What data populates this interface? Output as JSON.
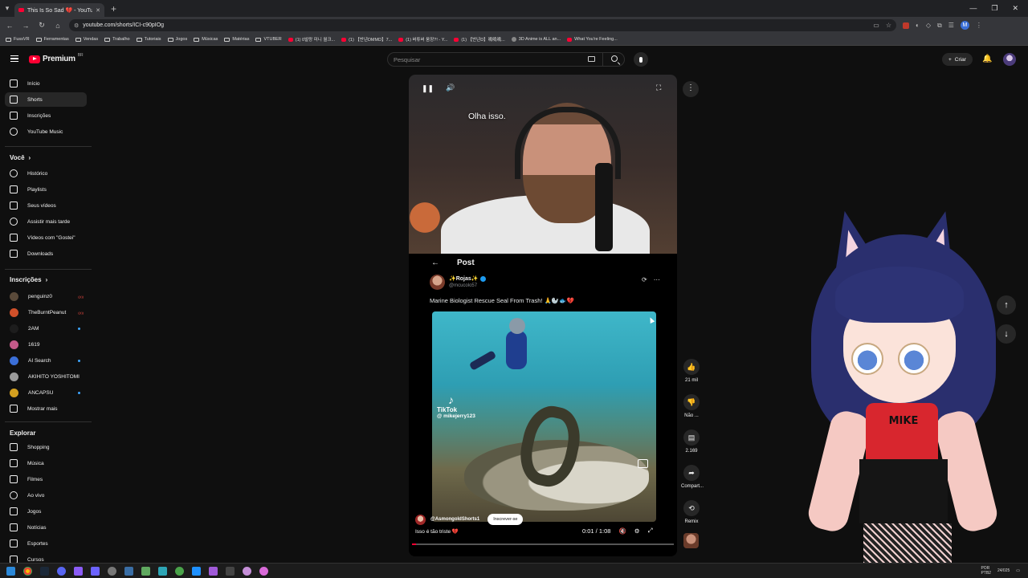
{
  "browser": {
    "tab_title": "This Is So Sad 💔 - YouTub",
    "url": "youtube.com/shorts/ICI-c90pIOg",
    "profile_initial": "M",
    "bookmarks": [
      {
        "label": "FussVR",
        "icon": "folder"
      },
      {
        "label": "Ferramentas",
        "icon": "folder"
      },
      {
        "label": "Vendas",
        "icon": "folder"
      },
      {
        "label": "Trabalho",
        "icon": "folder"
      },
      {
        "label": "Tutoriais",
        "icon": "folder"
      },
      {
        "label": "Jogos",
        "icon": "folder"
      },
      {
        "label": "Músicas",
        "icon": "folder"
      },
      {
        "label": "Matérias",
        "icon": "folder"
      },
      {
        "label": "VTUBER",
        "icon": "folder"
      },
      {
        "label": "(1) 0발랑 미니 월크...",
        "icon": "youtube"
      },
      {
        "label": "(1) 【반년DMMD】7...",
        "icon": "youtube"
      },
      {
        "label": "(1) 버튜버 움장?! - Y...",
        "icon": "youtube"
      },
      {
        "label": "(1) 【반년D】嗚嗚嗚...",
        "icon": "youtube"
      },
      {
        "label": "3D Anime is ALL an...",
        "icon": "blender"
      },
      {
        "label": "What You're Feeling...",
        "icon": "youtube"
      }
    ]
  },
  "header": {
    "logo_text": "Premium",
    "logo_region": "BR",
    "search_placeholder": "Pesquisar",
    "create_label": "Criar"
  },
  "sidebar": {
    "main": [
      {
        "label": "Início",
        "icon": "home-icon"
      },
      {
        "label": "Shorts",
        "icon": "shorts-icon",
        "active": true
      },
      {
        "label": "Inscrições",
        "icon": "subscriptions-icon"
      },
      {
        "label": "YouTube Music",
        "icon": "music-icon"
      }
    ],
    "you_heading": "Você",
    "you": [
      {
        "label": "Histórico",
        "icon": "history-icon"
      },
      {
        "label": "Playlists",
        "icon": "playlist-icon"
      },
      {
        "label": "Seus vídeos",
        "icon": "video-icon"
      },
      {
        "label": "Assistir mais tarde",
        "icon": "clock-icon"
      },
      {
        "label": "Vídeos com \"Gostei\"",
        "icon": "like-icon"
      },
      {
        "label": "Downloads",
        "icon": "download-icon"
      }
    ],
    "subs_heading": "Inscrições",
    "subs": [
      {
        "label": "penguinz0",
        "color": "#5a4a3a",
        "badge": "live"
      },
      {
        "label": "TheBurntPeanut",
        "color": "#d0502a",
        "badge": "live"
      },
      {
        "label": "2AM",
        "color": "#1d1d1d",
        "badge": "dot"
      },
      {
        "label": "1619",
        "color": "#c45a8a",
        "badge": ""
      },
      {
        "label": "AI Search",
        "color": "#3b6fd8",
        "badge": "dot"
      },
      {
        "label": "AKIHITO YOSHITOMI",
        "color": "#9a9a9a",
        "badge": ""
      },
      {
        "label": "ANCAPSU",
        "color": "#d4a020",
        "badge": "dot"
      }
    ],
    "show_more": "Mostrar mais",
    "explore_heading": "Explorar",
    "explore": [
      {
        "label": "Shopping",
        "icon": "bag-icon"
      },
      {
        "label": "Música",
        "icon": "note-icon"
      },
      {
        "label": "Filmes",
        "icon": "film-icon"
      },
      {
        "label": "Ao vivo",
        "icon": "live-icon"
      },
      {
        "label": "Jogos",
        "icon": "gamepad-icon"
      },
      {
        "label": "Notícias",
        "icon": "news-icon"
      },
      {
        "label": "Esportes",
        "icon": "trophy-icon"
      },
      {
        "label": "Cursos",
        "icon": "bulb-icon"
      }
    ]
  },
  "short": {
    "caption": "Olha isso.",
    "post_title": "Post",
    "author_name": "✨Rojas✨",
    "author_handle": "@mcucolo57",
    "post_text": "Marine Biologist Rescue Seal From Trash! 🙏🦭🐟💔",
    "tiktok_label": "TikTok",
    "tiktok_handle": "@ mikejerry123",
    "channel": "@AsmongoldShorts1",
    "subscribe_label": "Inscrever-se",
    "title": "Isso é tão triste 💔",
    "time": "0:01 / 1:08",
    "progress": 0.015
  },
  "actions": {
    "likes": "21 mil",
    "dislike": "Não ...",
    "comments": "2.169",
    "share": "Compart...",
    "remix": "Remix"
  },
  "vtuber": {
    "shirt_text": "MIKE"
  },
  "taskbar": {
    "lang_top": "POR",
    "lang_bottom": "PTB2",
    "date": "24/0",
    "time_suffix": "25"
  }
}
